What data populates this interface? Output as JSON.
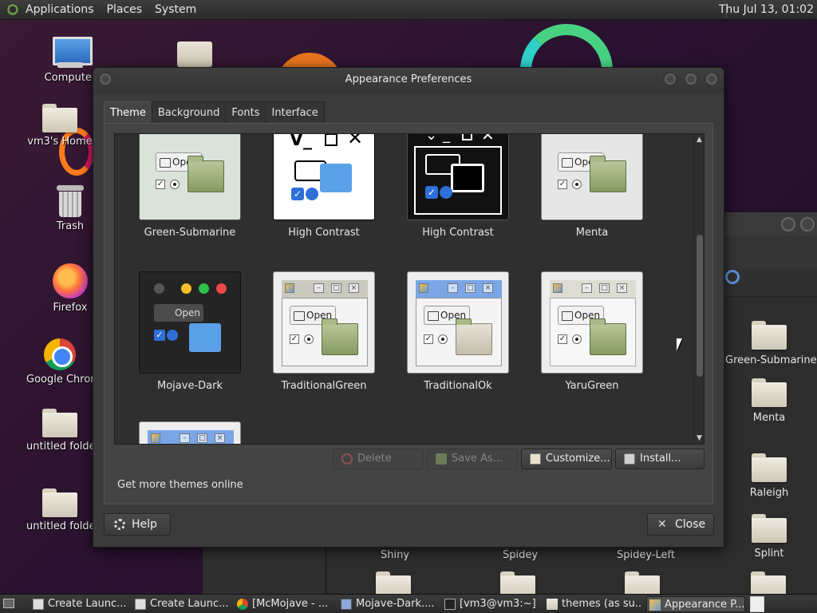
{
  "top_panel": {
    "menus": [
      "Applications",
      "Places",
      "System"
    ],
    "clock": "Thu Jul 13, 01:02"
  },
  "desktop": {
    "icons": [
      {
        "label": "Computer",
        "icon": "computer-icon"
      },
      {
        "label": "vm3's Home",
        "icon": "home-folder-icon"
      },
      {
        "label": "Trash",
        "icon": "trash-icon"
      },
      {
        "label": "Firefox",
        "icon": "firefox-icon"
      },
      {
        "label": "Google Chrome",
        "icon": "chrome-icon"
      },
      {
        "label": "untitled folder",
        "icon": "folder-icon"
      },
      {
        "label": "untitled folder",
        "icon": "folder-icon"
      }
    ]
  },
  "bg_file_manager": {
    "right_folders": [
      "Green-Submarine",
      "Menta",
      "Raleigh",
      "Splint"
    ],
    "bottom_folders": [
      "Shiny",
      "Spidey",
      "Spidey-Left"
    ]
  },
  "window": {
    "title": "Appearance Preferences",
    "tabs": [
      "Theme",
      "Background",
      "Fonts",
      "Interface"
    ],
    "active_tab": "Theme",
    "themes": [
      {
        "name": "Green-Submarine",
        "style": "green-submarine"
      },
      {
        "name": "High Contrast",
        "style": "high-contrast"
      },
      {
        "name": "High Contrast",
        "style": "high-contrast-inverse"
      },
      {
        "name": "Menta",
        "style": "menta"
      },
      {
        "name": "Mojave-Dark",
        "style": "mojave-dark"
      },
      {
        "name": "TraditionalGreen",
        "style": "traditional-green"
      },
      {
        "name": "TraditionalOk",
        "style": "traditional-ok"
      },
      {
        "name": "YaruGreen",
        "style": "yaru-green"
      }
    ],
    "thumb_open_label": "Open",
    "buttons": {
      "delete": "Delete",
      "save_as": "Save As...",
      "customize": "Customize...",
      "install": "Install..."
    },
    "get_more": "Get more themes online",
    "help": "Help",
    "close": "Close"
  },
  "taskbar": {
    "tasks": [
      {
        "label": "Create Launc...",
        "icon": "launcher-icon"
      },
      {
        "label": "Create Launc...",
        "icon": "launcher-icon"
      },
      {
        "label": "[McMojave - ...",
        "icon": "chrome-icon"
      },
      {
        "label": "Mojave-Dark....",
        "icon": "text-editor-icon"
      },
      {
        "label": "[vm3@vm3:~]",
        "icon": "terminal-icon"
      },
      {
        "label": "themes (as su...",
        "icon": "folder-icon"
      },
      {
        "label": "Appearance P...",
        "icon": "appearance-icon"
      }
    ]
  },
  "colors": {
    "accent_blue": "#4d8ce8",
    "folder_green": "#869b63"
  }
}
